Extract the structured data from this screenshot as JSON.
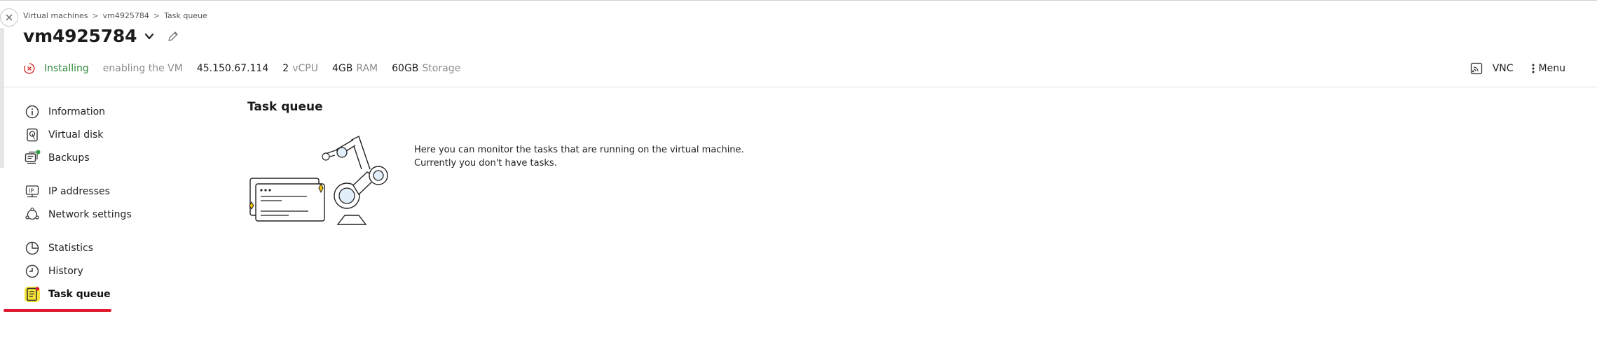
{
  "breadcrumb": {
    "items": [
      "Virtual machines",
      "vm4925784",
      "Task queue"
    ],
    "separator": ">"
  },
  "header": {
    "title": "vm4925784"
  },
  "status": {
    "state": "Installing",
    "substate": "enabling the VM",
    "ip": "45.150.67.114",
    "cpu_value": "2",
    "cpu_unit": "vCPU",
    "ram_value": "4GB",
    "ram_unit": "RAM",
    "storage_value": "60GB",
    "storage_unit": "Storage"
  },
  "actions": {
    "vnc_label": "VNC",
    "menu_label": "Menu"
  },
  "sidebar": {
    "items": [
      {
        "label": "Information",
        "icon": "info-icon"
      },
      {
        "label": "Virtual disk",
        "icon": "disk-icon"
      },
      {
        "label": "Backups",
        "icon": "backups-icon"
      },
      {
        "label": "IP addresses",
        "icon": "ip-icon"
      },
      {
        "label": "Network settings",
        "icon": "network-icon"
      },
      {
        "label": "Statistics",
        "icon": "pie-chart-icon"
      },
      {
        "label": "History",
        "icon": "clock-icon"
      },
      {
        "label": "Task queue",
        "icon": "task-queue-icon",
        "active": true
      }
    ]
  },
  "main": {
    "title": "Task queue",
    "empty_line1": "Here you can monitor the tasks that are running on the virtual machine.",
    "empty_line2": "Currently you don't have tasks."
  },
  "colors": {
    "installing": "#2e8b3a",
    "status_error_icon": "#d8322c",
    "active_underline": "#e0182d",
    "active_icon_bg": "#f5e23a",
    "notification_dot": "#2e9e43",
    "illustration_accent": "#f2c200"
  }
}
